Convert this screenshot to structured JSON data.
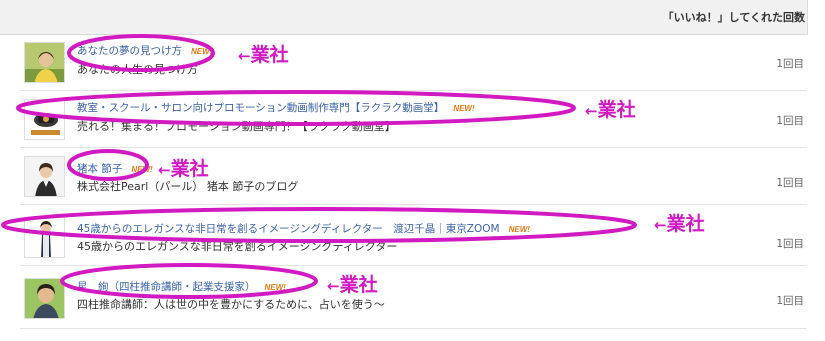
{
  "header": {
    "title": "「いいね！」してくれた回数"
  },
  "rows": [
    {
      "name": "あなたの夢の見つけ方",
      "new_badge": "NEW!",
      "description": "あなたの人生の見つけ方",
      "count": "1回目",
      "avatar": "avatar-person-photo"
    },
    {
      "name": "教室・スクール・サロン向けプロモーション動画制作専門【ラクラク動画堂】",
      "new_badge": "NEW!",
      "description": "売れる！集まる！プロモーション動画専門！【ラクラク動画堂】",
      "count": "1回目",
      "avatar": "avatar-logo"
    },
    {
      "name": "猪本 節子",
      "new_badge": "NEW!",
      "description": "株式会社Pearl（パール） 猪本 節子のブログ",
      "count": "1回目",
      "avatar": "avatar-person-photo"
    },
    {
      "name": "45歳からのエレガンスな非日常を創るイメージングディレクター　渡辺千晶｜東京ZOOM",
      "new_badge": "NEW!",
      "description": "45歳からのエレガンスな非日常を創るイメージングディレクター",
      "count": "1回目",
      "avatar": "avatar-person-photo"
    },
    {
      "name": "星　絢（四柱推命講師・起業支援家）",
      "new_badge": "NEW!",
      "description": "四柱推命講師：人は世の中を豊かにするために、占いを使う～",
      "count": "1回目",
      "avatar": "avatar-person-photo"
    }
  ],
  "annotations": [
    {
      "arrow": "←",
      "label": "業社"
    },
    {
      "arrow": "←",
      "label": "業社"
    },
    {
      "arrow": "←",
      "label": "業社"
    },
    {
      "arrow": "←",
      "label": "業社"
    },
    {
      "arrow": "←",
      "label": "業社"
    }
  ],
  "colors": {
    "annotation": "#d21ac2",
    "link": "#3a62a8",
    "new_badge": "#e27a16"
  }
}
